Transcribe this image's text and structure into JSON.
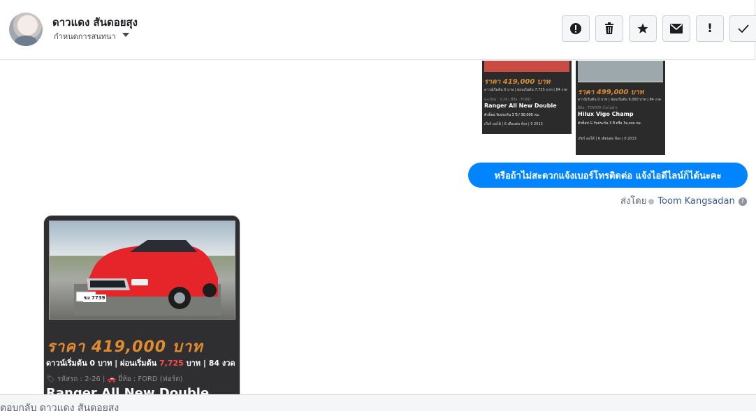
{
  "contact": {
    "name": "ดาวแดง สันดอยสุง",
    "assign_label": "กำหนดการสนทนา"
  },
  "toolbar": {
    "buttons": [
      {
        "name": "mark-spam",
        "icon": "alert-circle-icon"
      },
      {
        "name": "delete",
        "icon": "trash-icon"
      },
      {
        "name": "star",
        "icon": "star-icon"
      },
      {
        "name": "mark-unread",
        "icon": "envelope-icon"
      },
      {
        "name": "important",
        "icon": "exclamation-icon"
      },
      {
        "name": "mark-done",
        "icon": "checkmark-icon"
      }
    ]
  },
  "messages": {
    "small_cards": [
      {
        "price": "ราคา 419,000 บาท",
        "line": "ดาวน์เริ่มต้น 0 บาท | ผ่อนเริ่มต้น 7,725 บาท | 84 งวด",
        "tags": "ทะเบียน : 2-26 | ยี่ห้อ : FORD",
        "title": "Ranger All New Double",
        "warranty": "ตัวท็อป รับประกัน 3 ปี / 30,000 กม.",
        "footer": "เกียร์ ออโต้ | 6 เดือนต่อ ท้อง | 0 2013"
      },
      {
        "price": "ราคา 499,000 บาท",
        "line": "ดาวน์เริ่มต้น 0 บาท | ผ่อนเริ่มต้น 9,000 บาท | 84 งวด",
        "tags": "ยี่ห้อ : TOYOTA (โตโยต้า)",
        "title": "Hilux Vigo Champ",
        "warranty": "ตัวท็อป G รับประกัน 3 ปี หรือ 3x,xxx กม.",
        "footer": "เกียร์ ออโต้ | 6 เดือนต่อ ท้อง | 0 2013"
      }
    ],
    "outgoing_bubble": "หรือถ้าไม่สะดวกแจ้งเบอร์โทรติดต่อ แจ้งไอดีไลน์ก็ได้นะคะ",
    "sent_by_prefix": "ส่งโดย",
    "sent_by_agent": "Toom Kangsadan",
    "help_mark": "?",
    "incoming_card": {
      "plate": "ฆง 7739",
      "price": "ราคา 419,000 บาท",
      "line_part1": "ดาวน์เริ่มต้น 0 บาท | ผ่อนเริ่มต้น ",
      "line_red": "7,725",
      "line_part2": " บาท | 84 งวด",
      "tags": "🏷 รหัสรถ : 2-26 | 🚗 ยี่ห้อ : FORD (ฟอร์ด)",
      "title": "Ranger All New Double"
    }
  },
  "footer": {
    "reply_placeholder": "ตอบกลับ ดาวแดง สันดอยสุง"
  },
  "colors": {
    "bubble": "#0084ff",
    "agent_link": "#385898",
    "price_orange": "#e28b2e",
    "card_dark": "#2f2f31"
  }
}
